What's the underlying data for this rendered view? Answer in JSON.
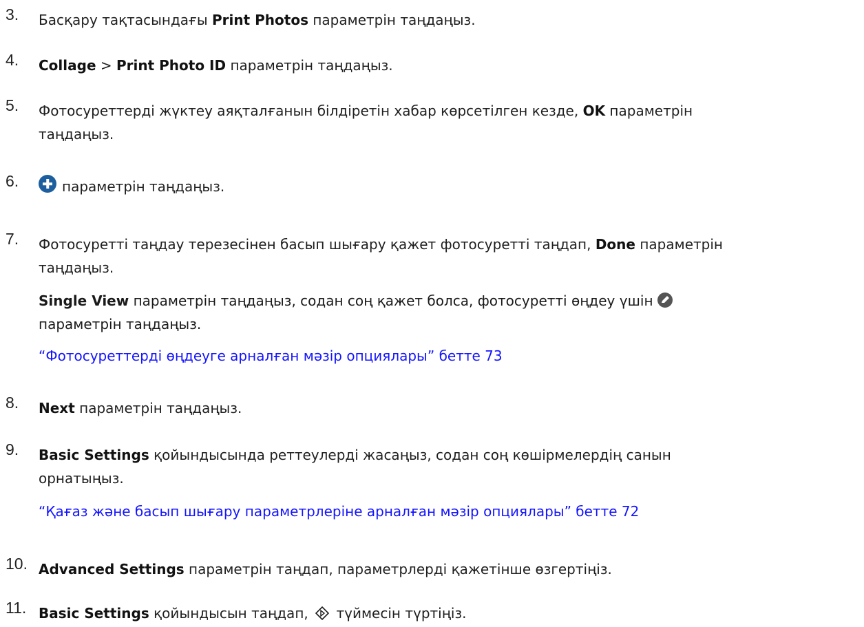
{
  "steps": [
    {
      "num": "3.",
      "b1": "Print Photos",
      "t0": "Басқару тақтасындағы ",
      "t1": " параметрін таңдаңыз."
    },
    {
      "num": "4.",
      "b1": "Collage",
      "t1": " > ",
      "b2": "Print Photo ID",
      "t2": " параметрін таңдаңыз."
    },
    {
      "num": "5.",
      "t0": "Фотосуреттерді жүктеу аяқталғанын білдіретін хабар көрсетілген кезде, ",
      "b1": "OK",
      "t1": " параметрін",
      "t2": "таңдаңыз."
    },
    {
      "num": "6.",
      "icon": "plus-circle-icon",
      "t1": "параметрін таңдаңыз."
    },
    {
      "num": "7.",
      "t0": "Фотосуретті таңдау терезесінен басып шығару қажет фотосуретті таңдап, ",
      "b1": "Done",
      "t1": " параметрін",
      "t2": "таңдаңыз.",
      "sub_b": "Single View",
      "sub_t1": " параметрін таңдаңыз, содан соң қажет болса, фотосуретті өңдеу үшін",
      "sub_icon": "pencil-icon",
      "sub_t2": "параметрін таңдаңыз.",
      "link": "“Фотосуреттерді өңдеуге арналған мәзір опциялары” бетте 73"
    },
    {
      "num": "8.",
      "b1": "Next",
      "t1": " параметрін таңдаңыз."
    },
    {
      "num": "9.",
      "b1": "Basic Settings",
      "t1": " қойындысында реттеулерді жасаңыз, содан соң көшірмелердің санын",
      "t2": "орнатыңыз.",
      "link": "“Қағаз және басып шығару параметрлеріне арналған мәзір опциялары” бетте 72"
    },
    {
      "num": "10.",
      "b1": "Advanced Settings",
      "t1": " параметрін таңдап, параметрлерді қажетінше өзгертіңіз."
    },
    {
      "num": "11.",
      "b1": "Basic Settings",
      "t1": " қойындысын таңдап, ",
      "icon": "start-icon",
      "t2": " түймесін түртіңіз."
    }
  ]
}
